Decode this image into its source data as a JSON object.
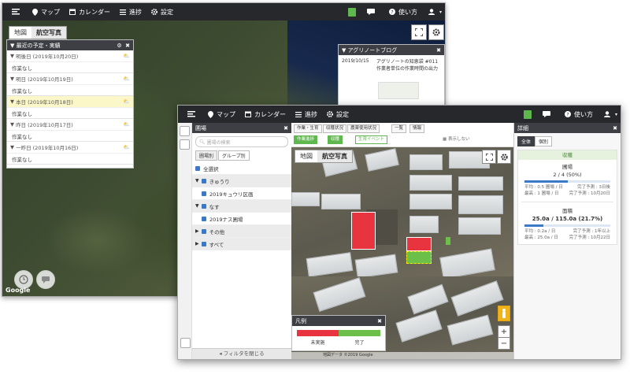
{
  "nav": {
    "map": "マップ",
    "calendar": "カレンダー",
    "list": "進捗",
    "settings": "設定",
    "help": "使い方"
  },
  "back": {
    "map_tabs": [
      "地図",
      "航空写真"
    ],
    "panel_title": "最近の予定・実績",
    "items": [
      {
        "date": "明後日 (2019年10月20日)",
        "note": "作業なし"
      },
      {
        "date": "明日 (2019年10月19日)",
        "note": "作業なし"
      },
      {
        "date": "本日 (2019年10月18日)",
        "note": "作業なし"
      },
      {
        "date": "昨日 (2019年10月17日)",
        "note": "作業なし"
      },
      {
        "date": "一昨日 (2019年10月16日)",
        "note": "作業なし"
      }
    ],
    "blog": {
      "title": "アグリノートブログ",
      "date": "2019/10/15",
      "text": "アグリノートの知恵袋 #011 作業者単位の作業時間の出力"
    },
    "google": "Google"
  },
  "front": {
    "panel_title": "圃場",
    "search_placeholder": "圃場の検索",
    "tabs": [
      "圃場別",
      "グループ別"
    ],
    "tree": [
      {
        "label": "全選択",
        "kind": "top"
      },
      {
        "label": "きゅうり",
        "kind": "group"
      },
      {
        "label": "2019キュウリ区画",
        "kind": "sub"
      },
      {
        "label": "なす",
        "kind": "group"
      },
      {
        "label": "2019ナス圃場",
        "kind": "sub"
      },
      {
        "label": "その他",
        "kind": "group"
      },
      {
        "label": "すべて",
        "kind": "group"
      }
    ],
    "filter": "フィルタを閉じる",
    "map_buttons_row1": [
      "作業・生育",
      "収穫状況",
      "農薬使用状況",
      "一覧",
      "情報"
    ],
    "map_buttons_row2": [
      "作業進捗",
      "収穫",
      "生育イベント",
      "表示しない"
    ],
    "map_tabs": [
      "地図",
      "航空写真"
    ],
    "legend": {
      "title": "凡例",
      "labels": [
        "未実施",
        "完了"
      ],
      "colors": [
        "#e8343f",
        "#6cc04a"
      ]
    },
    "attribution": "地図データ ©2019 Google"
  },
  "info": {
    "title": "詳細",
    "tabs": [
      "全体",
      "個別"
    ],
    "section": "収穫",
    "block1": {
      "label": "圃場",
      "value": "2 / 4 (50%)",
      "progress": 0.5,
      "l1": "平均 : 0.5 圃場 / 日",
      "r1": "完了予測 : 3日後",
      "l2": "最高 : 1 圃場 / 日",
      "r2": "完了予測 : 10月20日"
    },
    "block2": {
      "label": "面積",
      "value": "25.0a / 115.0a (21.7%)",
      "progress": 0.217,
      "l1": "平均 : 0.2a / 日",
      "r1": "完了予測 : 1年以上",
      "l2": "最高 : 25.0a / 日",
      "r2": "完了予測 : 10月22日"
    }
  },
  "colors": {
    "nav": "#26282c",
    "accent_green": "#5fb84d",
    "progress_blue": "#3b78c8",
    "red_field": "#e8343f"
  }
}
